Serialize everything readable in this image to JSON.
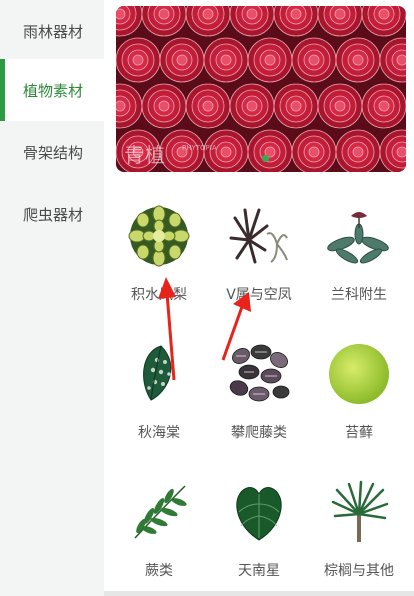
{
  "sidebar": {
    "items": [
      {
        "label": "雨林器材"
      },
      {
        "label": "植物素材"
      },
      {
        "label": "骨架结构"
      },
      {
        "label": "爬虫器材"
      }
    ],
    "active_index": 1
  },
  "banner": {
    "logo_text": "青植",
    "logo_sub": "PHYTOPIA",
    "dots": 1
  },
  "categories": [
    {
      "label": "积水凤梨",
      "icon": "bromeliad-icon"
    },
    {
      "label": "V属与空凤",
      "icon": "air-plant-icon"
    },
    {
      "label": "兰科附生",
      "icon": "orchid-icon"
    },
    {
      "label": "秋海棠",
      "icon": "begonia-icon"
    },
    {
      "label": "攀爬藤类",
      "icon": "vine-icon"
    },
    {
      "label": "苔藓",
      "icon": "moss-icon"
    },
    {
      "label": "蕨类",
      "icon": "fern-icon"
    },
    {
      "label": "天南星",
      "icon": "anthurium-icon"
    },
    {
      "label": "棕榈与其他",
      "icon": "palm-icon"
    }
  ],
  "colors": {
    "accent": "#2e9a44",
    "sidebar_bg": "#f3f5f5",
    "annotation_arrow": "#e8231b"
  }
}
